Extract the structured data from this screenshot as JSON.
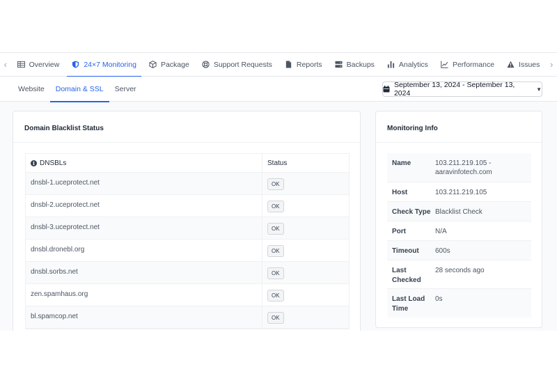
{
  "main_tabs": [
    {
      "label": "Overview",
      "icon": "table-icon"
    },
    {
      "label": "24×7 Monitoring",
      "icon": "shield-icon"
    },
    {
      "label": "Package",
      "icon": "box-icon"
    },
    {
      "label": "Support Requests",
      "icon": "lifebuoy-icon"
    },
    {
      "label": "Reports",
      "icon": "document-icon"
    },
    {
      "label": "Backups",
      "icon": "server-icon"
    },
    {
      "label": "Analytics",
      "icon": "bar-chart-icon"
    },
    {
      "label": "Performance",
      "icon": "line-chart-icon"
    },
    {
      "label": "Issues",
      "icon": "warning-icon"
    }
  ],
  "sub_tabs": [
    "Website",
    "Domain & SSL",
    "Server"
  ],
  "date_range": "September 13, 2024 - September 13, 2024",
  "blacklist": {
    "title": "Domain Blacklist Status",
    "col_dnsbl": "DNSBLs",
    "col_status": "Status",
    "rows": [
      {
        "name": "dnsbl-1.uceprotect.net",
        "status": "OK"
      },
      {
        "name": "dnsbl-2.uceprotect.net",
        "status": "OK"
      },
      {
        "name": "dnsbl-3.uceprotect.net",
        "status": "OK"
      },
      {
        "name": "dnsbl.dronebl.org",
        "status": "OK"
      },
      {
        "name": "dnsbl.sorbs.net",
        "status": "OK"
      },
      {
        "name": "zen.spamhaus.org",
        "status": "OK"
      },
      {
        "name": "bl.spamcop.net",
        "status": "OK"
      }
    ]
  },
  "monitoring": {
    "title": "Monitoring Info",
    "rows": [
      {
        "label": "Name",
        "value": "103.211.219.105 - aaravinfotech.com"
      },
      {
        "label": "Host",
        "value": "103.211.219.105"
      },
      {
        "label": "Check Type",
        "value": "Blacklist Check"
      },
      {
        "label": "Port",
        "value": "N/A"
      },
      {
        "label": "Timeout",
        "value": "600s"
      },
      {
        "label": "Last Checked",
        "value": "28 seconds ago"
      },
      {
        "label": "Last Load Time",
        "value": "0s"
      }
    ]
  },
  "colors": {
    "accent": "#2563eb"
  }
}
